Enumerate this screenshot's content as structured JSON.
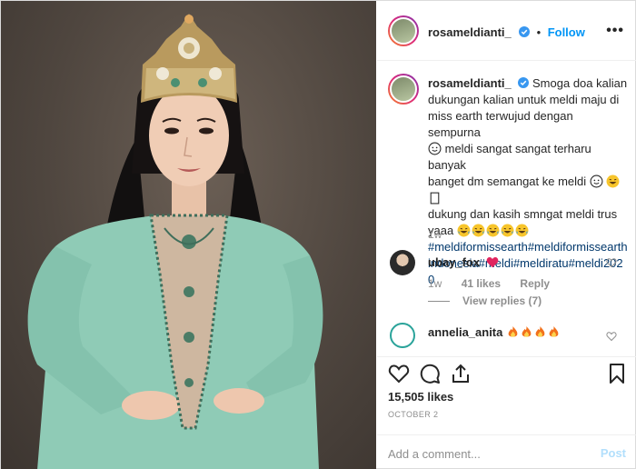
{
  "post": {
    "author": "rosameldianti_",
    "follow_label": "Follow",
    "more_label": "•••",
    "caption": {
      "line1": "Smoga doa kalian",
      "line2": "dukungan kalian untuk meldi maju di",
      "line3": "miss earth terwujud dengan sempurna",
      "line4": "meldi sangat sangat terharu banyak",
      "line5a": "banget dm semangat ke meldi",
      "line6": "dukung dan kasih smngat meldi trus",
      "line7": "yaaa",
      "hashtags_l1": "#meldiformissearth#meldiformissearth",
      "hashtags_l2": "indonesia#meldi#meldiratu#meldi202",
      "hashtags_l3": "0",
      "time": "1w"
    },
    "comments": [
      {
        "user": "ubay_fox",
        "time": "1w",
        "likes": "41 likes",
        "reply_label": "Reply",
        "view_replies": "View replies (7)"
      },
      {
        "user": "annelia_anita"
      }
    ],
    "likes_count": "15,505 likes",
    "date": "OCTOBER 2",
    "add_comment_placeholder": "Add a comment...",
    "post_label": "Post"
  },
  "colors": {
    "link": "#0095f6",
    "hashtag": "#00376b",
    "muted": "#8e8e8e",
    "dress": "#8fcbb6",
    "heart": "#ed4956"
  },
  "icons": [
    "verified-badge-icon",
    "more-options-icon",
    "heart-icon",
    "comment-icon",
    "share-icon",
    "bookmark-icon",
    "fire-emoji",
    "laughing-emoji",
    "smile-emoji"
  ]
}
